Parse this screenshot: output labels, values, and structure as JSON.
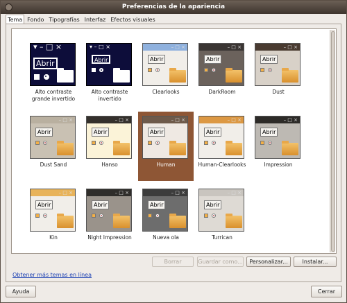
{
  "window": {
    "title": "Preferencias de la apariencia"
  },
  "tabs": [
    "Tema",
    "Fondo",
    "Tipografías",
    "Interfaz",
    "Efectos visuales"
  ],
  "themes": [
    {
      "label": "Alto contraste grande invertido",
      "style": "hc-big",
      "selected": false
    },
    {
      "label": "Alto contraste invertido",
      "style": "hc",
      "selected": false
    },
    {
      "label": "Clearlooks",
      "style": "clearlooks",
      "bar_color": "#8fb1de",
      "selected": false
    },
    {
      "label": "DarkRoom",
      "style": "darkroom",
      "bar_color": "#3a3533",
      "selected": false
    },
    {
      "label": "Dust",
      "style": "dust",
      "bar_color": "#4a3b31",
      "selected": false
    },
    {
      "label": "Dust Sand",
      "style": "dustsand",
      "bar_color": "#b9b0a0",
      "selected": false
    },
    {
      "label": "Hanso",
      "style": "hanso",
      "bar_color": "#34302c",
      "selected": false
    },
    {
      "label": "Human",
      "style": "human",
      "bar_color": "#6e5a4a",
      "selected": true
    },
    {
      "label": "Human-Clearlooks",
      "style": "humanclear",
      "bar_color": "#dc9843",
      "selected": false
    },
    {
      "label": "Impression",
      "style": "impression",
      "bar_color": "#2d2b28",
      "selected": false
    },
    {
      "label": "Kin",
      "style": "kin",
      "bar_color": "#e8b35a",
      "selected": false
    },
    {
      "label": "Night Impression",
      "style": "nightimp",
      "bar_color": "#2f2d2a",
      "selected": false
    },
    {
      "label": "Nueva ola",
      "style": "nuevaola",
      "bar_color": "#3c3c3c",
      "selected": false
    },
    {
      "label": "Turrican",
      "style": "turrican",
      "bar_color": "#c9c5bf",
      "selected": false
    }
  ],
  "thumb_button_label": "Abrir",
  "actions": {
    "delete": "Borrar",
    "save_as": "Guardar como...",
    "customize": "Personalizar...",
    "install": "Instalar..."
  },
  "more_themes_link": "Obtener más temas en línea",
  "footer": {
    "help": "Ayuda",
    "close": "Cerrar"
  }
}
